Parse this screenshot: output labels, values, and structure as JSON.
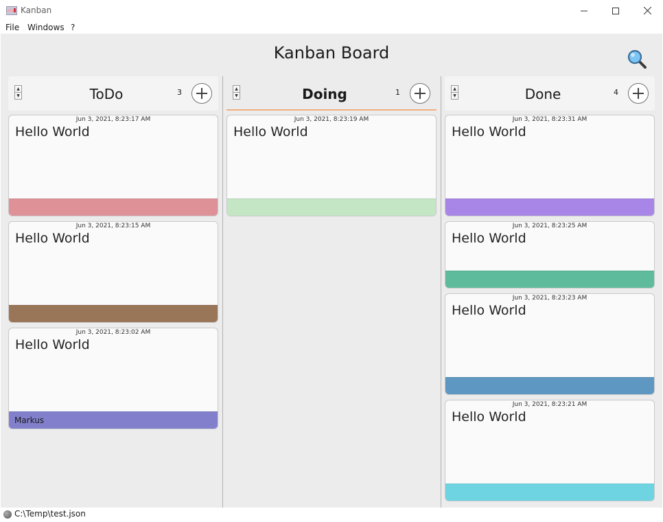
{
  "window": {
    "title": "Kanban",
    "minimize_icon": "minimize-icon",
    "maximize_icon": "maximize-icon",
    "close_icon": "close-icon"
  },
  "menu": {
    "items": [
      "File",
      "Windows",
      "?"
    ]
  },
  "board": {
    "title": "Kanban Board",
    "search_icon": "search-icon"
  },
  "columns": [
    {
      "name": "ToDo",
      "count": "3",
      "active": false,
      "cards": [
        {
          "date": "Jun 3, 2021, 8:23:17 AM",
          "text": "Hello World",
          "footer": "",
          "color": "#de9298",
          "height": 148
        },
        {
          "date": "Jun 3, 2021, 8:23:15 AM",
          "text": "Hello World",
          "footer": "",
          "color": "#9a7658",
          "height": 148
        },
        {
          "date": "Jun 3, 2021, 8:23:02 AM",
          "text": "Hello World",
          "footer": "Markus",
          "color": "#8280cc",
          "height": 148
        }
      ]
    },
    {
      "name": "Doing",
      "count": "1",
      "active": true,
      "cards": [
        {
          "date": "Jun 3, 2021, 8:23:19 AM",
          "text": "Hello World",
          "footer": "",
          "color": "#c4e6c4",
          "height": 148
        }
      ]
    },
    {
      "name": "Done",
      "count": "4",
      "active": false,
      "cards": [
        {
          "date": "Jun 3, 2021, 8:23:31 AM",
          "text": "Hello World",
          "footer": "",
          "color": "#a886e8",
          "height": 148
        },
        {
          "date": "Jun 3, 2021, 8:23:25 AM",
          "text": "Hello World",
          "footer": "",
          "color": "#5ebc9c",
          "height": 98
        },
        {
          "date": "Jun 3, 2021, 8:23:23 AM",
          "text": "Hello World",
          "footer": "",
          "color": "#5e98c2",
          "height": 148
        },
        {
          "date": "Jun 3, 2021, 8:23:21 AM",
          "text": "Hello World",
          "footer": "",
          "color": "#6ed4e2",
          "height": 148
        }
      ]
    }
  ],
  "status": {
    "path": "C:\\Temp\\test.json"
  }
}
